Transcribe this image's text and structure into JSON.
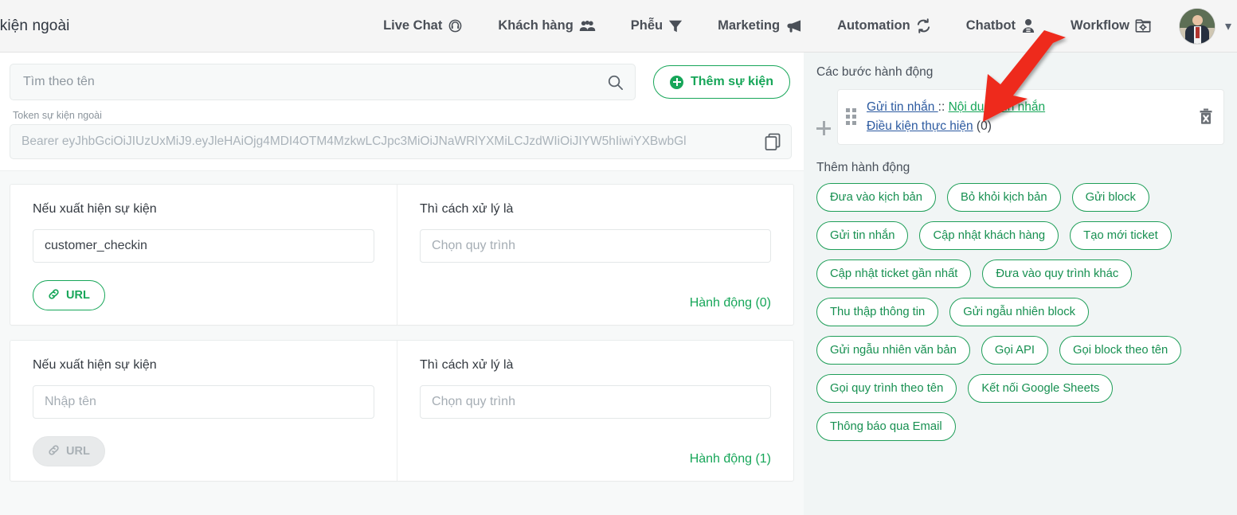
{
  "topnav": {
    "title": "r kiện ngoài",
    "items": [
      {
        "label": "Live Chat",
        "icon": "headset-icon"
      },
      {
        "label": "Khách hàng",
        "icon": "users-icon"
      },
      {
        "label": "Phễu",
        "icon": "funnel-icon"
      },
      {
        "label": "Marketing",
        "icon": "megaphone-icon"
      },
      {
        "label": "Automation",
        "icon": "refresh-icon"
      },
      {
        "label": "Chatbot",
        "icon": "robot-icon"
      },
      {
        "label": "Workflow",
        "icon": "workflow-gear-icon"
      }
    ],
    "avatar_alt": "User avatar",
    "chevron": "▾"
  },
  "left": {
    "search": {
      "placeholder": "Tìm theo tên",
      "value": ""
    },
    "add_event_button": "Thêm sự kiện",
    "token": {
      "label": "Token sự kiện ngoài",
      "value": "Bearer eyJhbGciOiJIUzUxMiJ9.eyJleHAiOjg4MDI4OTM4MzkwLCJpc3MiOiJNaWRlYXMiLCJzdWIiOiJIYW5hIiwiYXBwbGl",
      "copy_title": "copy"
    },
    "cards": [
      {
        "event_label": "Nếu xuất hiện sự kiện",
        "event_value": "customer_checkin",
        "event_placeholder": "",
        "url_button": "URL",
        "url_disabled": false,
        "handle_label": "Thì cách xử lý là",
        "process_placeholder": "Chọn quy trình",
        "action_count": "Hành động (0)"
      },
      {
        "event_label": "Nếu xuất hiện sự kiện",
        "event_value": "",
        "event_placeholder": "Nhập tên",
        "url_button": "URL",
        "url_disabled": true,
        "handle_label": "Thì cách xử lý là",
        "process_placeholder": "Chọn quy trình",
        "action_count": "Hành động (1)"
      }
    ]
  },
  "right": {
    "steps_title": "Các bước hành động",
    "step": {
      "action_name": "Gửi tin nhắn ",
      "separator": "::",
      "action_target": "Nội dung tin nhắn",
      "condition_label": "Điều kiện thực hiện",
      "condition_count": "(0)"
    },
    "add_action_title": "Thêm hành động",
    "chips": [
      "Đưa vào kịch bản",
      "Bỏ khỏi kịch bản",
      "Gửi block",
      "Gửi tin nhắn",
      "Cập nhật khách hàng",
      "Tạo mới ticket",
      "Cập nhật ticket gần nhất",
      "Đưa vào quy trình khác",
      "Thu thập thông tin",
      "Gửi ngẫu nhiên block",
      "Gửi ngẫu nhiên văn bản",
      "Gọi API",
      "Gọi block theo tên",
      "Gọi quy trình theo tên",
      "Kết nối Google Sheets",
      "Thông báo qua Email"
    ]
  },
  "colors": {
    "accent_green": "#17a659",
    "link_blue": "#2c5aa0",
    "annotation_red": "#ee2a1e",
    "nav_bg": "#f5f5f5",
    "panel_bg": "#f1f5f5"
  }
}
